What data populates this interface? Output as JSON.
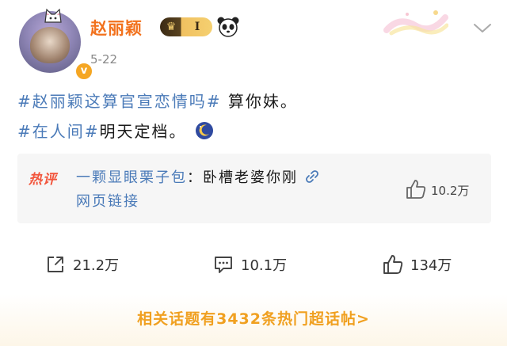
{
  "header": {
    "username": "赵丽颖",
    "vip_level": "I",
    "date": "5-22",
    "verified_mark": "v",
    "icons": [
      "crown-icon",
      "panda-icon",
      "chevron-down-icon"
    ]
  },
  "post": {
    "line1_topic": "#赵丽颖这算官宣恋情吗#",
    "line1_text": " 算你妹。",
    "line2_topic": "#在人间#",
    "line2_text": "明天定档。",
    "emoji": "moon-emoji"
  },
  "hot_comment": {
    "tag": "热评",
    "author": "一颗显眼栗子包",
    "separator": "：",
    "text": "卧槽老婆你刚",
    "link_text": "网页链接",
    "likes": "10.2万"
  },
  "actions": {
    "share_count": "21.2万",
    "comment_count": "10.1万",
    "like_count": "134万"
  },
  "footer": {
    "related_link": "相关话题有3432条热门超话帖>"
  },
  "colors": {
    "username": "#f2711c",
    "topic": "#4a7ab8",
    "hot_tag": "#f2553c",
    "footer_link": "#f0a020"
  }
}
